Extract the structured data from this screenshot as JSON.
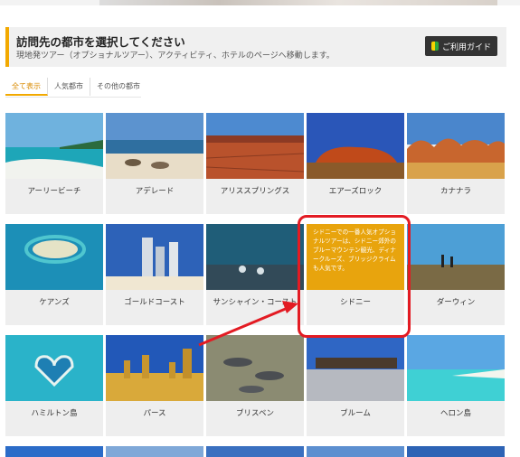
{
  "header": {
    "title": "訪問先の都市を選択してください",
    "subtitle": "現地発ツアー（オプショナルツアー）、アクティビティ、ホテルのページへ移動します。",
    "guide_button": "ご利用ガイド"
  },
  "tabs": [
    {
      "label": "全て表示",
      "active": true
    },
    {
      "label": "人気都市",
      "active": false
    },
    {
      "label": "その他の都市",
      "active": false
    }
  ],
  "cities": [
    {
      "name": "アーリービーチ"
    },
    {
      "name": "アデレード"
    },
    {
      "name": "アリススプリングス"
    },
    {
      "name": "エアーズロック"
    },
    {
      "name": "カナナラ"
    },
    {
      "name": "ケアンズ"
    },
    {
      "name": "ゴールドコースト"
    },
    {
      "name": "サンシャイン・コースト"
    },
    {
      "name": "シドニー",
      "hover_text": "シドニーでの一番人気オプショナルツアーは、シドニー郊外のブルーマウンテン観光、ディナークルーズ、ブリッジクライムも人気です。"
    },
    {
      "name": "ダーウィン"
    },
    {
      "name": "ハミルトン島"
    },
    {
      "name": "パース"
    },
    {
      "name": "ブリスベン"
    },
    {
      "name": "ブルーム"
    },
    {
      "name": "ヘロン島"
    }
  ],
  "colors": {
    "accent": "#f2a900",
    "highlight_red": "#e31b23",
    "overlay": "#e8a40d"
  }
}
